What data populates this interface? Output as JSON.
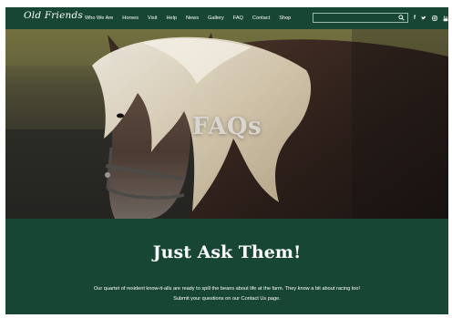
{
  "header": {
    "logo": "Old Friends",
    "menu": [
      "Who We Are",
      "Horses",
      "Visit",
      "Help",
      "News",
      "Gallery",
      "FAQ",
      "Contact",
      "Shop"
    ],
    "search": {
      "placeholder": "",
      "value": ""
    },
    "social": [
      "f",
      "twitter",
      "instagram",
      "youtube"
    ]
  },
  "hero": {
    "title": "FAQs"
  },
  "section": {
    "title": "Just Ask Them!",
    "text_line1": "Our quartet of resident know-it-alls are ready to spill the beans about life at the farm. They know a bit about racing too!",
    "text_line2": "Submit your questions on our Contact Us page."
  },
  "colors": {
    "brand_green": "#174634",
    "text_white": "#ffffff"
  }
}
